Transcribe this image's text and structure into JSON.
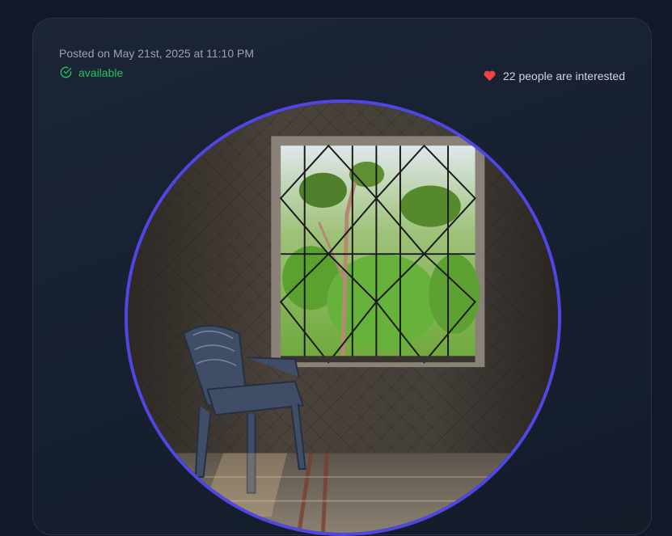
{
  "post": {
    "posted_text": "Posted on May 21st, 2025 at 11:10 PM",
    "status_label": "available",
    "interest_text": "22 people are interested"
  },
  "icons": {
    "status": "check-circle-icon",
    "interest": "heart-icon"
  },
  "colors": {
    "background": "#111827",
    "card": "#1a2332",
    "status_green": "#22c55e",
    "heart_red": "#ef4444",
    "photo_ring": "#4f46e5"
  },
  "image": {
    "shape": "circle",
    "subject": "plastic chair beside a barred window"
  }
}
